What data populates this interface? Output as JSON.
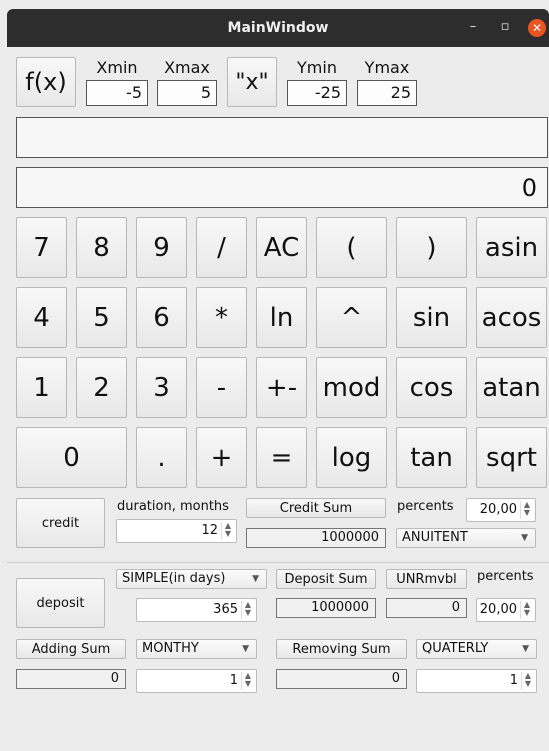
{
  "window": {
    "title": "MainWindow",
    "minimize_glyph": "–",
    "maximize_glyph": "▫",
    "close_glyph": "✕"
  },
  "graph": {
    "fx_label": "f(x)",
    "xmin_label": "Xmin",
    "xmin_value": "-5",
    "xmax_label": "Xmax",
    "xmax_value": "5",
    "x_label": "\"x\"",
    "ymin_label": "Ymin",
    "ymin_value": "-25",
    "ymax_label": "Ymax",
    "ymax_value": "25"
  },
  "display": {
    "expression": "",
    "result": "0"
  },
  "keys": {
    "row1": [
      "7",
      "8",
      "9",
      "/",
      "AC",
      "(",
      ")",
      "asin"
    ],
    "row2": [
      "4",
      "5",
      "6",
      "*",
      "ln",
      "^",
      "sin",
      "acos"
    ],
    "row3": [
      "1",
      "2",
      "3",
      "-",
      "+-",
      "mod",
      "cos",
      "atan"
    ],
    "row4": [
      "0",
      ".",
      "+",
      "=",
      "log",
      "tan",
      "sqrt"
    ]
  },
  "credit": {
    "button": "credit",
    "duration_label": "duration, months",
    "duration_value": "12",
    "sum_label": "Credit Sum",
    "sum_value": "1000000",
    "percents_label": "percents",
    "percents_value": "20,00",
    "type_selected": "ANUITENT"
  },
  "deposit": {
    "button": "deposit",
    "mode_selected": "SIMPLE(in days)",
    "days_value": "365",
    "sum_label": "Deposit Sum",
    "sum_value": "1000000",
    "unrmvbl_label": "UNRmvbl",
    "unrmvbl_value": "0",
    "percents_label": "percents",
    "percents_value": "20,00",
    "adding_label": "Adding Sum",
    "adding_value": "0",
    "adding_period": "MONTHY",
    "adding_count": "1",
    "removing_label": "Removing Sum",
    "removing_value": "0",
    "removing_period": "QUATERLY",
    "removing_count": "1"
  }
}
